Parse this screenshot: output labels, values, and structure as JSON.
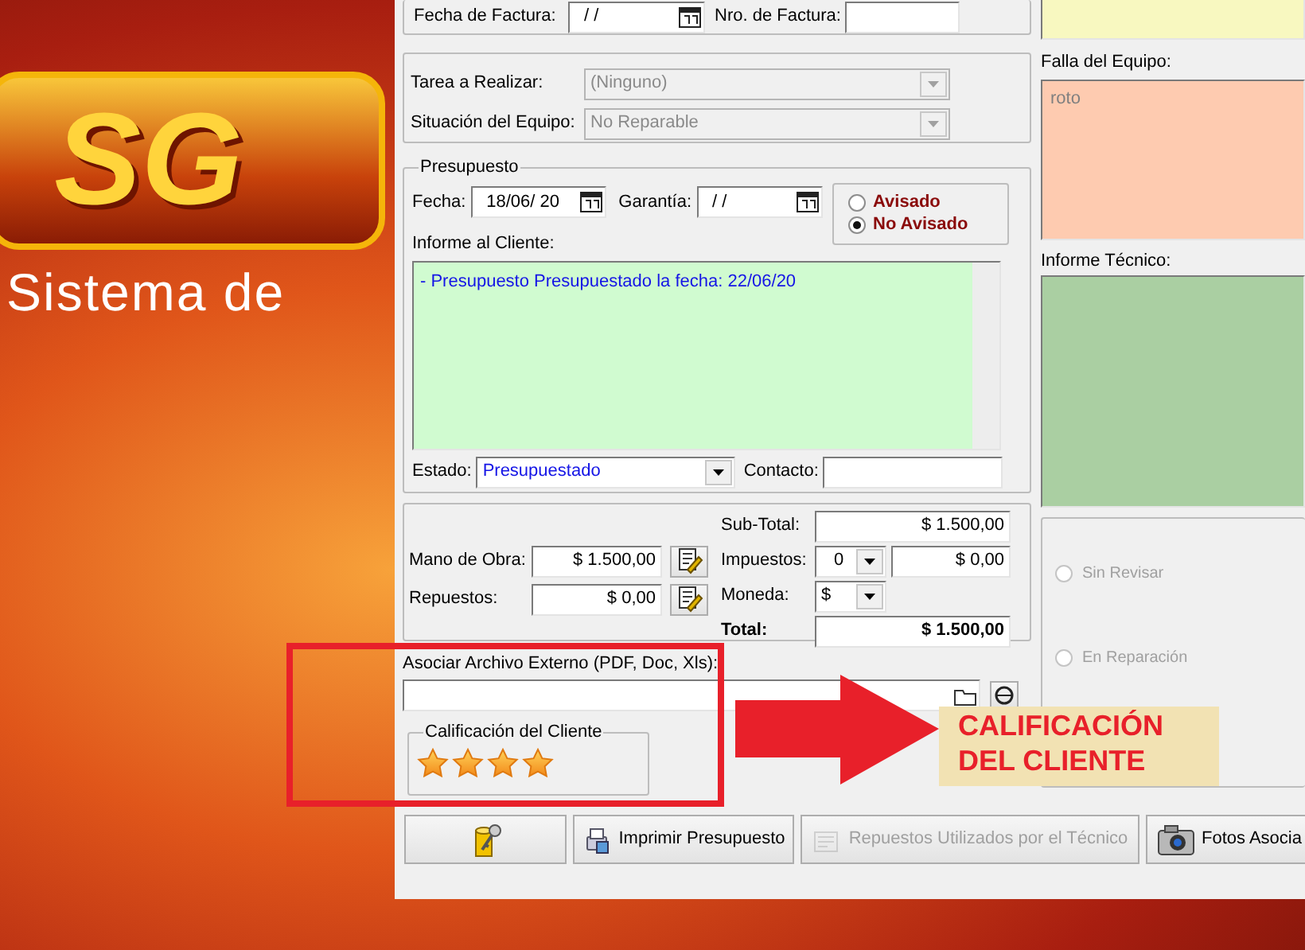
{
  "background": {
    "logo_text": "SG",
    "tagline": "Sistema de"
  },
  "invoice": {
    "date_label": "Fecha de Factura:",
    "date_value": "/ /",
    "number_label": "Nro. de Factura:"
  },
  "task": {
    "label": "Tarea a Realizar:",
    "value": "(Ninguno)",
    "disabled": true
  },
  "equipment_status": {
    "label": "Situación del Equipo:",
    "value": "No Reparable",
    "disabled": true
  },
  "budget": {
    "title": "Presupuesto",
    "date_label": "Fecha:",
    "date_value": "18/06/ 20",
    "warranty_label": "Garantía:",
    "warranty_value": "/ /",
    "notice_options": [
      {
        "label": "Avisado",
        "selected": false
      },
      {
        "label": "No Avisado",
        "selected": true
      }
    ],
    "report_label": "Informe al Cliente:",
    "report_text": "- Presupuesto Presupuestado la fecha: 22/06/20",
    "state_label": "Estado:",
    "state_value": "Presupuestado",
    "contact_label": "Contacto:"
  },
  "costs": {
    "labor_label": "Mano de Obra:",
    "labor_value": "$ 1.500,00",
    "parts_label": "Repuestos:",
    "parts_value": "$ 0,00",
    "subtotal_label": "Sub-Total:",
    "subtotal_value": "$ 1.500,00",
    "tax_label": "Impuestos:",
    "tax_rate": "0",
    "tax_value": "$ 0,00",
    "currency_label": "Moneda:",
    "currency_value": "$",
    "total_label": "Total:",
    "total_value": "$ 1.500,00"
  },
  "attachment": {
    "label": "Asociar Archivo Externo (PDF, Doc, Xls):"
  },
  "rating": {
    "title": "Calificación del Cliente",
    "stars": 4
  },
  "buttons": [
    {
      "kind": "key",
      "disabled": false
    },
    {
      "kind": "print",
      "label": "Imprimir Presupuesto",
      "disabled": false
    },
    {
      "kind": "parts",
      "label": "Repuestos Utilizados por el Técnico",
      "disabled": true
    },
    {
      "kind": "camera",
      "label": "Fotos Asocia",
      "disabled": false
    }
  ],
  "right_panel": {
    "fault_label": "Falla del Equipo:",
    "fault_text": "roto",
    "tech_report_label": "Informe Técnico:",
    "repair_states": [
      {
        "label": "Sin Revisar",
        "selected": false,
        "disabled": true
      },
      {
        "label": "En Reparación",
        "selected": false,
        "disabled": true
      }
    ]
  },
  "annotation": {
    "text": "CALIFICACIÓN DEL CLIENTE"
  }
}
